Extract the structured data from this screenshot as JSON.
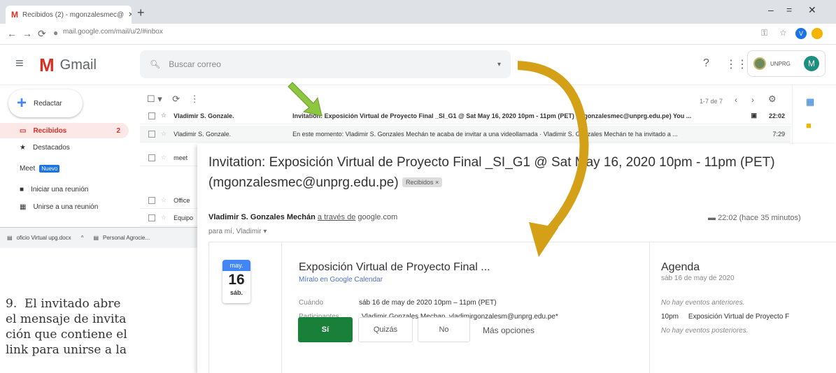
{
  "browser": {
    "tab_title": "Recibidos (2) - mgonzalesmec@",
    "url": "mail.google.com/mail/u/2/#inbox",
    "new_tab": "+",
    "avatar_letter": "V"
  },
  "gmail": {
    "app_name": "Gmail",
    "search_placeholder": "Buscar correo",
    "account_label": "UNPRG",
    "account_avatar": "M",
    "page_info": "1-7 de 7"
  },
  "sidebar": {
    "compose": "Redactar",
    "items": [
      {
        "label": "Recibidos",
        "count": "2"
      },
      {
        "label": "Destacados"
      }
    ],
    "meet_label": "Meet",
    "meet_badge": "Nuevo",
    "meet_items": [
      {
        "label": "Iniciar una reunión"
      },
      {
        "label": "Unirse a una reunión"
      }
    ]
  },
  "inbox": {
    "rows": [
      {
        "sender": "Vladimir S. Gonzale.",
        "subject": "Invitation: Exposición Virtual de Proyecto Final _SI_G1 @ Sat May 16, 2020 10pm - 11pm (PET) (mgonzalesmec@unprg.edu.pe)  You ...",
        "time": "22:02"
      },
      {
        "sender": "Vladimir S. Gonzale.",
        "subject": "En este momento: Vladimir S. Gonzales Mechán te acaba de invitar a una videollamada · Vladimir S. Gonzales Mechán te ha invitado a ...",
        "time": "7:29"
      },
      {
        "sender": "meet",
        "subject": "",
        "time": ""
      },
      {
        "sender": "Office",
        "subject": "",
        "time": ""
      },
      {
        "sender": "Equipo",
        "subject": "",
        "time": ""
      }
    ]
  },
  "taskbar": {
    "items": [
      {
        "label": "oficio Virtual upg.docx"
      },
      {
        "label": "Personal Agrocie..."
      }
    ]
  },
  "message": {
    "subject": "Invitation: Exposición Virtual de Proyecto Final _SI_G1 @ Sat May 16, 2020 10pm - 11pm (PET) (mgonzalesmec@unprg.edu.pe)",
    "label": "Recibidos ×",
    "sender_name": "Vladimir S. Gonzales Mechán",
    "via": "a través de",
    "via_domain": "google.com",
    "timestamp": "22:02 (hace 35 minutos)",
    "to": "para mí, Vladimir ▾"
  },
  "event": {
    "month": "may.",
    "day": "16",
    "dow": "sáb.",
    "title": "Exposición Virtual de Proyecto Final ...",
    "view_link": "Míralo en Google Calendar",
    "when_label": "Cuándo",
    "when_value": "sáb 16 de may de 2020 10pm – 11pm (PET)",
    "participants_label": "Participantes",
    "participants_value": "Vladimir Gonzales Mechan, vladimirgonzalesm@unprg.edu.pe*",
    "btn_yes": "Sí",
    "btn_maybe": "Quizás",
    "btn_no": "No",
    "more": "Más opciones"
  },
  "agenda": {
    "title": "Agenda",
    "date": "sáb 16 de may de 2020",
    "no_prev": "No hay eventos anteriores.",
    "ev_time": "10pm",
    "ev_title": "Exposición Virtual de Proyecto F",
    "no_next": "No hay eventos posteriores."
  },
  "caption": "9.  El invitado abre\nel mensaje de invita\nción que contiene el\nlink para unirse a la",
  "colors": {
    "arrow_green": "#8dc63f",
    "arrow_gold": "#d4a017",
    "gmail_red": "#d93025",
    "accept_green": "#188038"
  }
}
